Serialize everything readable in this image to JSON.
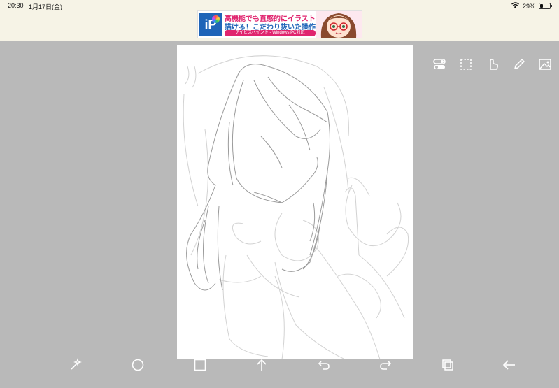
{
  "status_bar": {
    "time": "20:30",
    "date": "1月17日(金)",
    "battery_percent": 29,
    "battery_label": "29%",
    "wifi_icon": "wifi-icon",
    "battery_icon": "battery-icon"
  },
  "ad": {
    "logo_text": "iP",
    "line1": "高機能でも直感的にイラストが",
    "line2": "描ける！こだわり抜いた操作性！",
    "line3": "アイビスペイント - Windows PC対応"
  },
  "right_toolbar": [
    {
      "icon": "toggle-icon"
    },
    {
      "icon": "selection-icon"
    },
    {
      "icon": "hand-icon"
    },
    {
      "icon": "pencil-icon"
    },
    {
      "icon": "layer-image-icon"
    }
  ],
  "bottom_toolbar": [
    {
      "icon": "magic-wand-icon"
    },
    {
      "icon": "circle-icon"
    },
    {
      "icon": "square-icon"
    },
    {
      "icon": "arrow-up-icon"
    },
    {
      "icon": "undo-icon"
    },
    {
      "icon": "redo-icon"
    },
    {
      "icon": "layers-icon"
    },
    {
      "icon": "back-arrow-icon"
    }
  ],
  "colors": {
    "background": "#b9b9b9",
    "status_bar_bg": "#f6f3e6",
    "canvas": "#ffffff",
    "icon": "#ffffff"
  }
}
